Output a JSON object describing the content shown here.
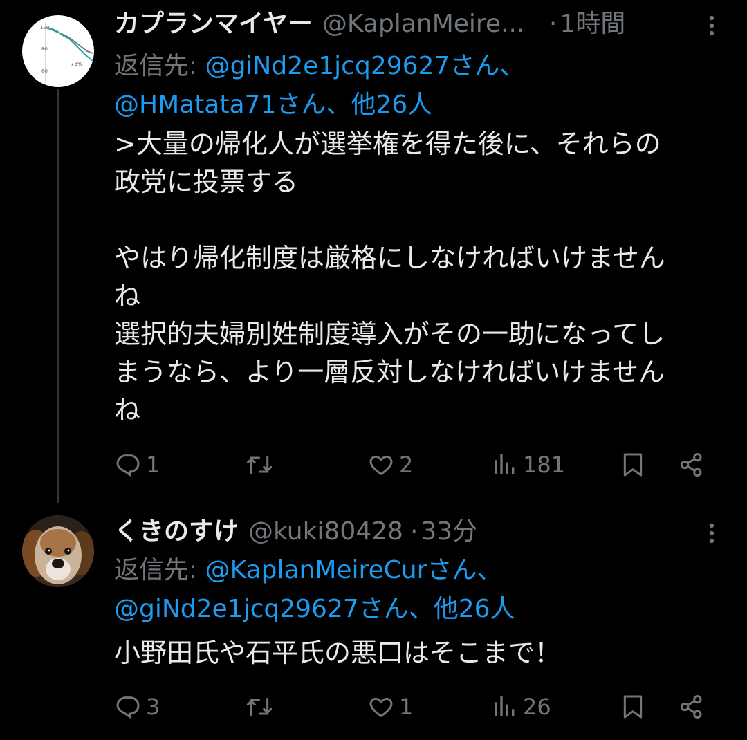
{
  "colors": {
    "background": "#000000",
    "text": "#e7e9ea",
    "muted": "#71767b",
    "link": "#1d9bf0",
    "thread_line": "#333639"
  },
  "tweets": [
    {
      "display_name": "カプランマイヤー",
      "handle": "@KaplanMeire...",
      "separator": "·",
      "time": "1時間",
      "reply_prefix": "返信先: ",
      "reply_mentions_line1": "@giNd2e1jcq29627さん、",
      "reply_mentions_line2": "@HMatata71さん、他26人",
      "body": ">大量の帰化人が選挙権を得た後に、それらの\n政党に投票する\n\nやはり帰化制度は厳格にしなければいけません\nね\n選択的夫婦別姓制度導入がその一助になってし\nまうなら、より一層反対しなければいけません\nね",
      "avatar": {
        "type": "chart-thumbnail",
        "tick_labels": [
          "100",
          "80",
          "60"
        ],
        "annotation": "73%"
      },
      "actions": {
        "replies": "1",
        "reposts": "",
        "likes": "2",
        "views": "181"
      }
    },
    {
      "display_name": "くきのすけ",
      "handle": "@kuki80428",
      "separator": "·",
      "time": "33分",
      "reply_prefix": "返信先: ",
      "reply_mentions_line1": "@KaplanMeireCurさん、",
      "reply_mentions_line2": "@giNd2e1jcq29627さん、他26人",
      "body": "小野田氏や石平氏の悪口はそこまで！",
      "avatar": {
        "type": "dog-photo"
      },
      "actions": {
        "replies": "3",
        "reposts": "",
        "likes": "1",
        "views": "26"
      }
    }
  ],
  "icons": {
    "more": "more-vertical-icon",
    "reply": "reply-bubble-icon",
    "repost": "repost-arrows-icon",
    "like": "heart-icon",
    "views": "views-bar-chart-icon",
    "bookmark": "bookmark-icon",
    "share": "share-icon"
  }
}
